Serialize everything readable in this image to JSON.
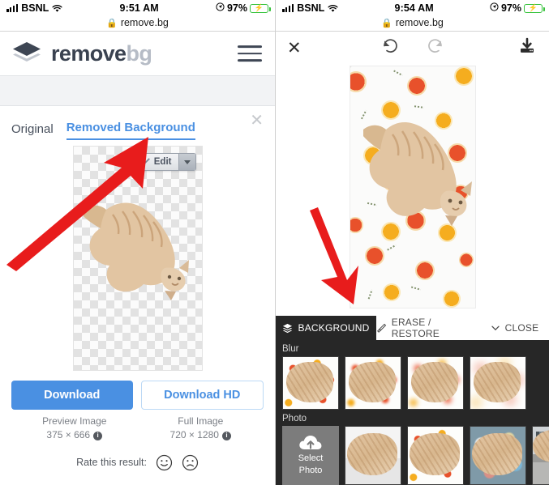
{
  "left": {
    "status": {
      "carrier": "BSNL",
      "time": "9:51 AM",
      "battery": "97%",
      "wifi_icon": "wifi-icon",
      "signal_icon": "signal-bars-icon",
      "battery_icon": "battery-charging-icon",
      "location_icon": "location-arrow-icon"
    },
    "url": {
      "domain": "remove.bg",
      "lock_icon": "lock-icon"
    },
    "header": {
      "brand_1": "remove",
      "brand_2": "bg",
      "logo_icon": "layers-logo-icon",
      "menu_icon": "hamburger-menu-icon"
    },
    "tabs": {
      "original": "Original",
      "removed": "Removed Background",
      "close_icon": "close-x-icon"
    },
    "preview": {
      "edit_label": "Edit",
      "brush_icon": "brush-icon",
      "caret_icon": "chevron-down-icon",
      "canvas_icon": "transparency-checkerboard"
    },
    "download": {
      "primary_label": "Download",
      "secondary_label": "Download HD",
      "preview_title": "Preview Image",
      "preview_dims": "375 × 666",
      "full_title": "Full Image",
      "full_dims": "720 × 1280",
      "info_icon": "info-icon"
    },
    "rate": {
      "label": "Rate this result:",
      "happy_icon": "smiley-happy-icon",
      "sad_icon": "smiley-sad-icon"
    }
  },
  "right": {
    "status": {
      "carrier": "BSNL",
      "time": "9:54 AM",
      "battery": "97%"
    },
    "url": {
      "domain": "remove.bg"
    },
    "toolbar": {
      "close_icon": "close-x-icon",
      "undo_icon": "undo-arrow-icon",
      "redo_icon": "redo-arrow-icon",
      "download_icon": "download-icon"
    },
    "editor_tabs": [
      {
        "label": "BACKGROUND",
        "icon": "layers-icon",
        "active": true
      },
      {
        "label": "ERASE / RESTORE",
        "icon": "brush-icon",
        "active": false
      },
      {
        "label": "CLOSE",
        "icon": "chevron-down-icon",
        "active": false
      }
    ],
    "sections": [
      {
        "label": "Blur",
        "thumbs": [
          {
            "name": "blur-level-0",
            "blur": "blur1"
          },
          {
            "name": "blur-level-1",
            "blur": "blur2"
          },
          {
            "name": "blur-level-2",
            "blur": "blur3"
          },
          {
            "name": "blur-level-3",
            "blur": "blur4"
          }
        ]
      },
      {
        "label": "Photo",
        "select_photo_label_1": "Select",
        "select_photo_label_2": "Photo",
        "select_photo_icon": "cloud-upload-icon",
        "thumbs": [
          {
            "name": "photo-studio-white"
          },
          {
            "name": "photo-citrus-dots"
          },
          {
            "name": "photo-bokeh"
          },
          {
            "name": "photo-urban-street"
          }
        ]
      }
    ]
  },
  "colors": {
    "accent_blue": "#4a90e2",
    "panel_dark": "#272727",
    "arrow_red": "#e81c1c",
    "battery_green": "#35c23a"
  }
}
